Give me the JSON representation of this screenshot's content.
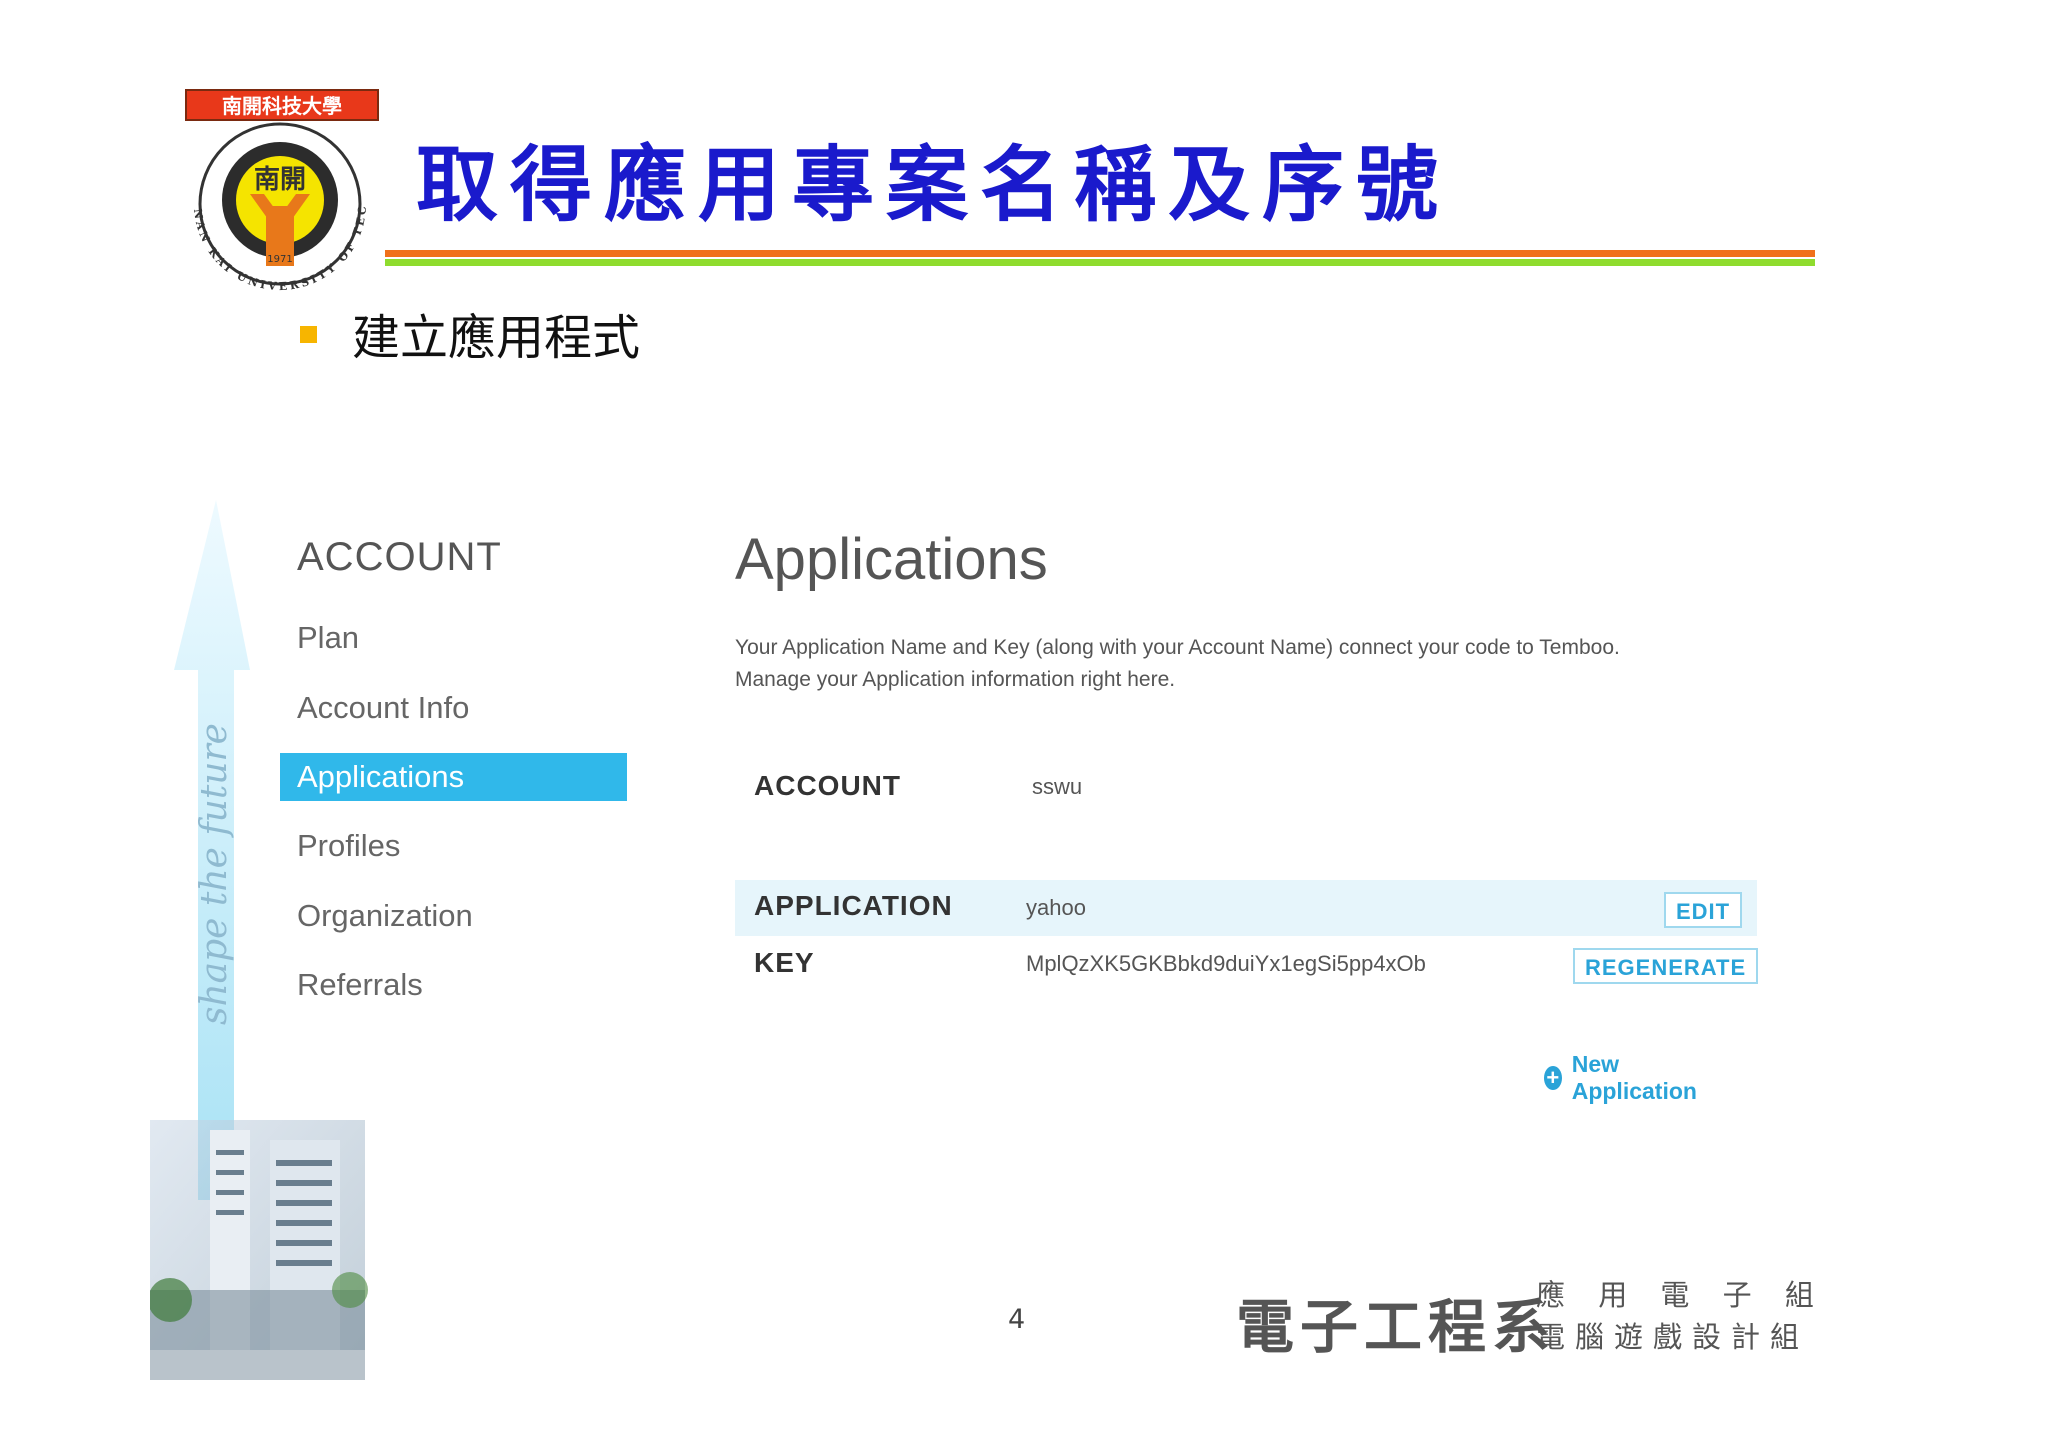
{
  "slide": {
    "title": "取得應用專案名稱及序號",
    "bullet": "建立應用程式",
    "page_number": "4",
    "logo": {
      "top_text": "南開科技大學",
      "center_text": "南開",
      "year": "1971",
      "ring_text": "NAN KAI UNIVERSITY OF TECHNOLOGY"
    },
    "side_motto": "shape the future",
    "footer": {
      "dept": "電子工程系",
      "line1": "應 用 電 子 組",
      "line2": "電腦遊戲設計組"
    },
    "colors": {
      "title": "#1a1acc",
      "rule_top": "#f0701a",
      "rule_bottom": "#8fdc2e",
      "bullet": "#f7b500"
    }
  },
  "app": {
    "sidebar": {
      "heading": "ACCOUNT",
      "items": [
        {
          "label": "Plan",
          "active": false
        },
        {
          "label": "Account Info",
          "active": false
        },
        {
          "label": "Applications",
          "active": true
        },
        {
          "label": "Profiles",
          "active": false
        },
        {
          "label": "Organization",
          "active": false
        },
        {
          "label": "Referrals",
          "active": false
        }
      ]
    },
    "main": {
      "title": "Applications",
      "description_line1": "Your Application Name and Key (along with your Account Name) connect your code to Temboo.",
      "description_line2": "Manage your Application information right here.",
      "account": {
        "label": "ACCOUNT",
        "value": "sswu"
      },
      "application": {
        "label": "APPLICATION",
        "value": "yahoo",
        "edit_label": "EDIT"
      },
      "key": {
        "label": "KEY",
        "value": "MplQzXK5GKBbkd9duiYx1egSi5pp4xOb",
        "regenerate_label": "REGENERATE"
      },
      "new_application_label": "New Application"
    },
    "colors": {
      "accent": "#30b8ea",
      "link": "#2aa3d8",
      "band": "#e6f5fb"
    },
    "icons": {
      "new_application": "plus-circle-icon"
    }
  }
}
